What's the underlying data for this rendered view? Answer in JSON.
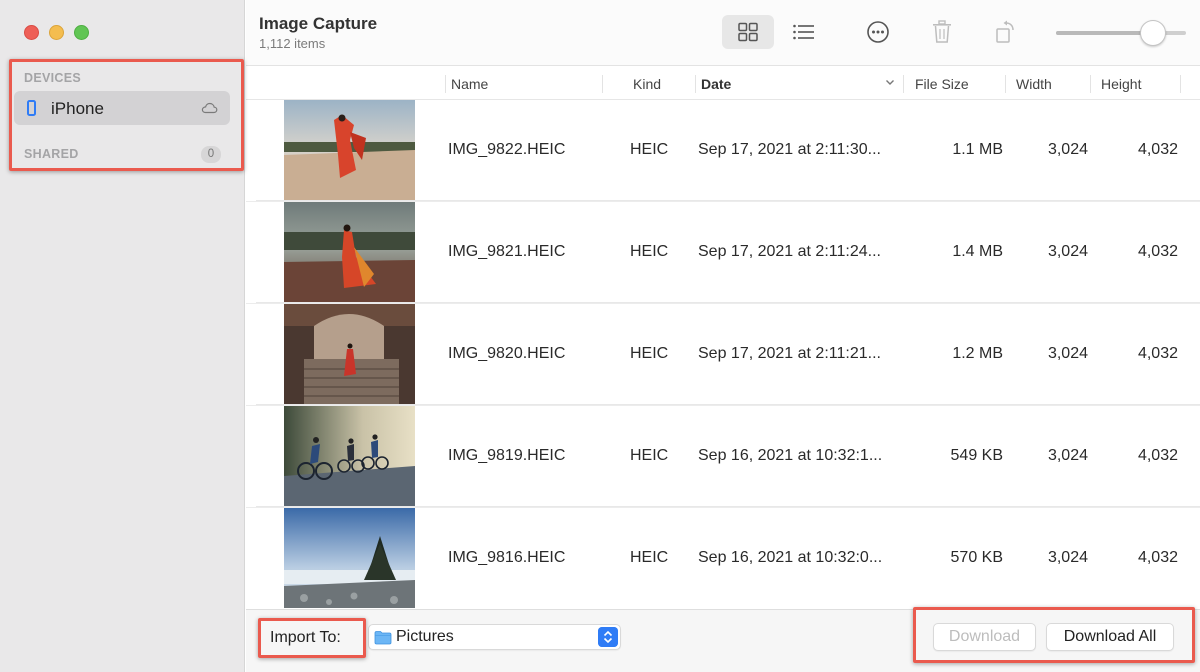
{
  "sidebar": {
    "devices_label": "DEVICES",
    "device_name": "iPhone",
    "shared_label": "SHARED",
    "shared_count": "0"
  },
  "toolbar": {
    "title": "Image Capture",
    "subtitle": "1,112 items",
    "icons": [
      "grid-view-icon",
      "list-view-icon",
      "more-icon",
      "trash-icon",
      "rotate-icon"
    ],
    "thumbnail_size_slider": 0.72
  },
  "table": {
    "columns": {
      "name": "Name",
      "kind": "Kind",
      "date": "Date",
      "file_size": "File Size",
      "width": "Width",
      "height": "Height"
    },
    "rows": [
      {
        "name": "IMG_9822.HEIC",
        "kind": "HEIC",
        "date": "Sep 17, 2021 at 2:11:30...",
        "size": "1.1 MB",
        "width": "3,024",
        "height": "4,032"
      },
      {
        "name": "IMG_9821.HEIC",
        "kind": "HEIC",
        "date": "Sep 17, 2021 at 2:11:24...",
        "size": "1.4 MB",
        "width": "3,024",
        "height": "4,032"
      },
      {
        "name": "IMG_9820.HEIC",
        "kind": "HEIC",
        "date": "Sep 17, 2021 at 2:11:21...",
        "size": "1.2 MB",
        "width": "3,024",
        "height": "4,032"
      },
      {
        "name": "IMG_9819.HEIC",
        "kind": "HEIC",
        "date": "Sep 16, 2021 at 10:32:1...",
        "size": "549 KB",
        "width": "3,024",
        "height": "4,032"
      },
      {
        "name": "IMG_9816.HEIC",
        "kind": "HEIC",
        "date": "Sep 16, 2021 at 10:32:0...",
        "size": "570 KB",
        "width": "3,024",
        "height": "4,032"
      }
    ]
  },
  "bottom": {
    "import_label": "Import To:",
    "import_value": "Pictures",
    "download_label": "Download",
    "download_all_label": "Download All"
  },
  "colors": {
    "accent": "#2f7cf6",
    "highlight": "#ea5a4e",
    "sidebar_bg": "#e9e8e9"
  }
}
